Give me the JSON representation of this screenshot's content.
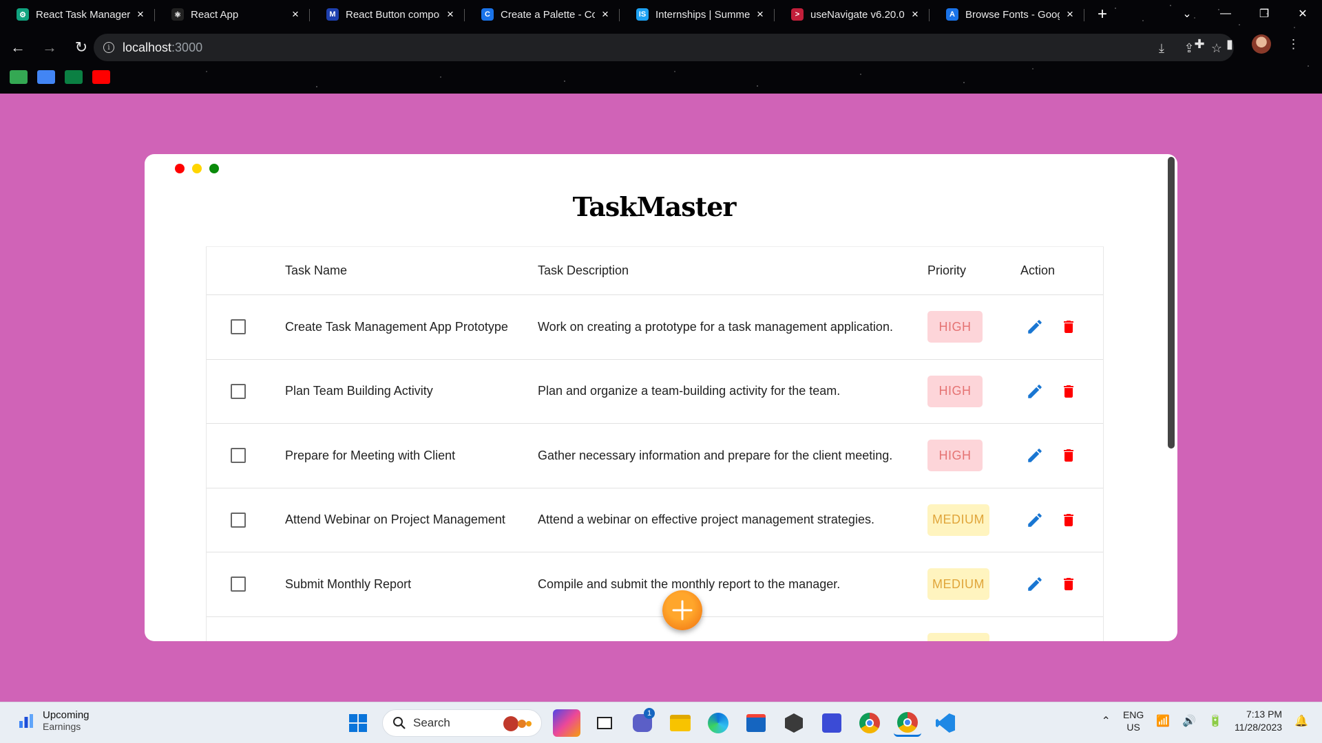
{
  "browser": {
    "tabs": [
      {
        "title": "React Task Manager /",
        "fav_color": "#10a37f",
        "fav_glyph": "⚙"
      },
      {
        "title": "React App",
        "fav_color": "#222",
        "fav_glyph": "⚛"
      },
      {
        "title": "React Button compon",
        "fav_color": "#1e40af",
        "fav_glyph": "M"
      },
      {
        "title": "Create a Palette - Co",
        "fav_color": "#1a73e8",
        "fav_glyph": "C"
      },
      {
        "title": "Internships | Summer",
        "fav_color": "#1da1f2",
        "fav_glyph": "IS"
      },
      {
        "title": "useNavigate v6.20.0",
        "fav_color": "#c21f3a",
        "fav_glyph": ">"
      },
      {
        "title": "Browse Fonts - Goog",
        "fav_color": "#1a73e8",
        "fav_glyph": "A"
      }
    ],
    "address": {
      "host": "localhost",
      "port": ":3000"
    },
    "bookmark_colors": [
      "#34a853",
      "#4285f4",
      "#0b8043",
      "#ff0000"
    ]
  },
  "app": {
    "title": "TaskMaster",
    "window_dots": [
      "#ff0000",
      "#ffd500",
      "#0a8a0a"
    ],
    "columns": {
      "name": "Task Name",
      "description": "Task Description",
      "priority": "Priority",
      "action": "Action"
    },
    "tasks": [
      {
        "name": "Create Task Management App Prototype",
        "description": "Work on creating a prototype for a task management application.",
        "priority": "HIGH"
      },
      {
        "name": "Plan Team Building Activity",
        "description": "Plan and organize a team-building activity for the team.",
        "priority": "HIGH"
      },
      {
        "name": "Prepare for Meeting with Client",
        "description": "Gather necessary information and prepare for the client meeting.",
        "priority": "HIGH"
      },
      {
        "name": "Attend Webinar on Project Management",
        "description": "Attend a webinar on effective project management strategies.",
        "priority": "MEDIUM"
      },
      {
        "name": "Submit Monthly Report",
        "description": "Compile and submit the monthly report to the manager.",
        "priority": "MEDIUM"
      }
    ],
    "colors": {
      "edit": "#1976d2",
      "delete": "#ff0000",
      "fab": "#f78a1d",
      "background": "#d063b7"
    }
  },
  "taskbar": {
    "weather_title": "Upcoming",
    "weather_subtitle": "Earnings",
    "search_label": "Search",
    "teams_badge": "1",
    "lang_top": "ENG",
    "lang_bottom": "US",
    "time": "7:13 PM",
    "date": "11/28/2023"
  }
}
